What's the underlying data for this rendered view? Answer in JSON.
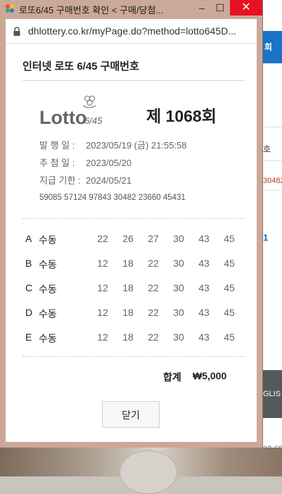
{
  "window": {
    "title": "로또6/45 구매번호 확인 < 구매/당첨...",
    "minimize_glyph": "–",
    "maximize_glyph": "☐",
    "close_glyph": "✕",
    "favicon": "lottery-clover-icon"
  },
  "address_bar": {
    "url": "dhlottery.co.kr/myPage.do?method=lotto645D...",
    "icon": "lock-icon"
  },
  "page": {
    "title": "인터넷 로또 6/45 구매번호",
    "logo_text": "Lotto",
    "logo_sub": "6/45",
    "round": "제 1068회"
  },
  "info": {
    "issue_label": "발 행 일 :",
    "issue_value": "2023/05/19 (금) 21:55:58",
    "draw_label": "추 첨 일 :",
    "draw_value": "2023/05/20",
    "deadline_label": "지급 기한 :",
    "deadline_value": "2024/05/21",
    "barcode": "59085 57124 97843 30482 23660 45431"
  },
  "games": [
    {
      "key": "A",
      "mode": "수동",
      "numbers": [
        "22",
        "26",
        "27",
        "30",
        "43",
        "45"
      ]
    },
    {
      "key": "B",
      "mode": "수동",
      "numbers": [
        "12",
        "18",
        "22",
        "30",
        "43",
        "45"
      ]
    },
    {
      "key": "C",
      "mode": "수동",
      "numbers": [
        "12",
        "18",
        "22",
        "30",
        "43",
        "45"
      ]
    },
    {
      "key": "D",
      "mode": "수동",
      "numbers": [
        "12",
        "18",
        "22",
        "30",
        "43",
        "45"
      ]
    },
    {
      "key": "E",
      "mode": "수동",
      "numbers": [
        "12",
        "18",
        "22",
        "30",
        "43",
        "45"
      ]
    }
  ],
  "total": {
    "label": "합계",
    "value": "₩5,000"
  },
  "close_button": "닫기",
  "background_page": {
    "blue_label": "회",
    "header_text": "호",
    "red_text": "30482",
    "blue_link": "1",
    "dark_text": "GLIS",
    "bottom_text": "02-69",
    "red_color": "#c0392b",
    "blue_color": "#1a73c4"
  }
}
